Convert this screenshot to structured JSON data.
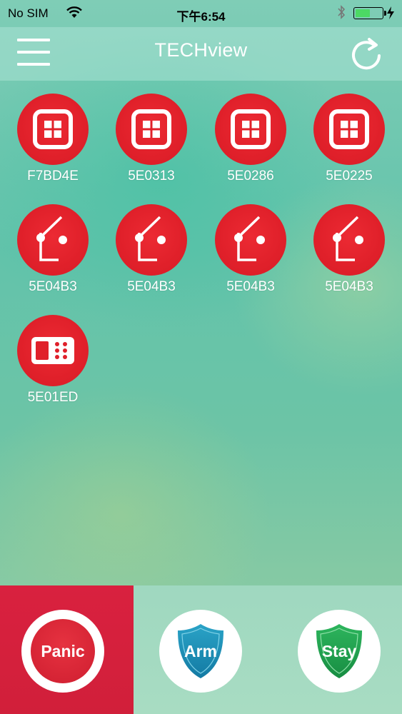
{
  "status_bar": {
    "carrier": "No SIM",
    "time": "下午6:54",
    "battery_level": 0.55,
    "battery_color": "#4cd964"
  },
  "nav": {
    "title": "TECHview",
    "menu_icon": "hamburger-menu-icon",
    "refresh_icon": "refresh-icon"
  },
  "devices": [
    {
      "label": "F7BD4E",
      "icon": "window-sensor-icon"
    },
    {
      "label": "5E0313",
      "icon": "window-sensor-icon"
    },
    {
      "label": "5E0286",
      "icon": "window-sensor-icon"
    },
    {
      "label": "5E0225",
      "icon": "window-sensor-icon"
    },
    {
      "label": "5E04B3",
      "icon": "door-sensor-icon"
    },
    {
      "label": "5E04B3",
      "icon": "door-sensor-icon"
    },
    {
      "label": "5E04B3",
      "icon": "door-sensor-icon"
    },
    {
      "label": "5E04B3",
      "icon": "door-sensor-icon"
    },
    {
      "label": "5E01ED",
      "icon": "keypad-icon"
    }
  ],
  "actions": {
    "panic": "Panic",
    "arm": "Arm",
    "stay": "Stay"
  },
  "colors": {
    "device_red": "#e0202a",
    "panic_red": "#d9213f",
    "arm_blue": "#1d8fb8",
    "stay_green": "#1fa050"
  }
}
